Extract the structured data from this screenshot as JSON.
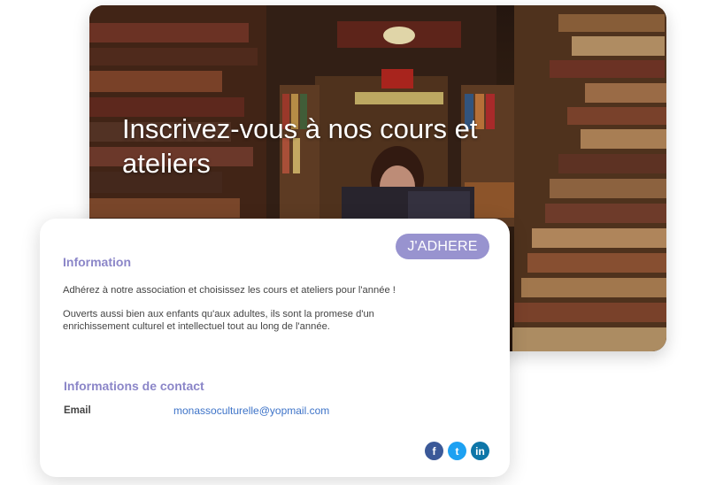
{
  "hero": {
    "title": "Inscrivez-vous à nos cours et ateliers",
    "image_content": "library bookshelves with stacked books arch and reader"
  },
  "card": {
    "join_button": "J'ADHERE",
    "info_title": "Information",
    "info_paragraphs": [
      "Adhérez à notre association et choisissez les cours et ateliers pour l'année !",
      "Ouverts aussi bien aux enfants qu'aux adultes, ils sont la promese d'un enrichissement culturel et intellectuel tout au long de l'année."
    ],
    "contact_title": "Informations de contact",
    "contact": {
      "email_label": "Email",
      "email_value": "monassoculturelle@yopmail.com"
    },
    "social": [
      {
        "icon": "facebook-icon",
        "color": "#3b5998",
        "glyph": "f"
      },
      {
        "icon": "twitter-icon",
        "color": "#1da1f2",
        "glyph": "t"
      },
      {
        "icon": "linkedin-icon",
        "color": "#0e76a8",
        "glyph": "in"
      }
    ]
  },
  "colors": {
    "accent": "#9893cf",
    "heading": "#8b86c8",
    "link": "#3d73c8"
  }
}
